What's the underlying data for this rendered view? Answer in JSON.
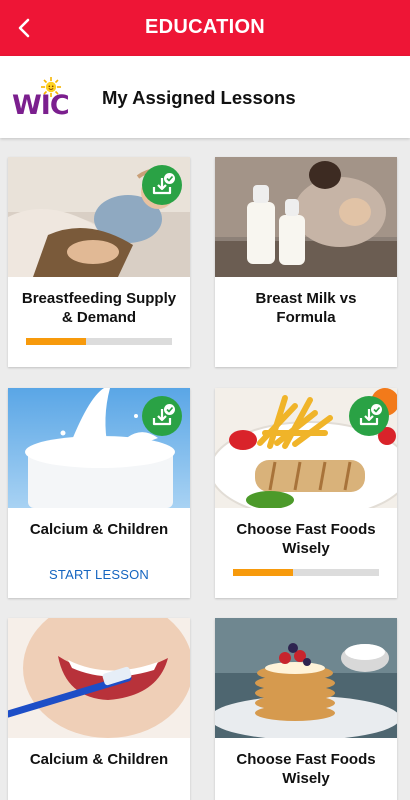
{
  "app_bar": {
    "title": "EDUCATION",
    "back_icon": "chevron-left-icon"
  },
  "header": {
    "logo_text": "WIC",
    "title": "My Assigned Lessons"
  },
  "colors": {
    "brand_red": "#ee1536",
    "wic_purple": "#7b1f8e",
    "download_green": "#2aa245",
    "progress_orange": "#f79a0c",
    "link_blue": "#1565c0"
  },
  "lessons": [
    {
      "title": "Breastfeeding Supply & Demand",
      "downloaded": true,
      "progress": 0.41,
      "image": "breastfeeding-photo"
    },
    {
      "title": "Breast Milk vs Formula",
      "downloaded": false,
      "image": "milk-bottles-photo"
    },
    {
      "title": "Calcium & Children",
      "downloaded": true,
      "action": "START LESSON",
      "image": "glass-of-milk-photo"
    },
    {
      "title": "Choose Fast Foods Wisely",
      "downloaded": true,
      "progress": 0.41,
      "image": "fries-and-wrap-photo"
    },
    {
      "title": "Calcium & Children",
      "downloaded": false,
      "image": "toothbrush-smile-photo"
    },
    {
      "title": "Choose Fast Foods Wisely",
      "downloaded": false,
      "image": "pancakes-photo"
    }
  ]
}
